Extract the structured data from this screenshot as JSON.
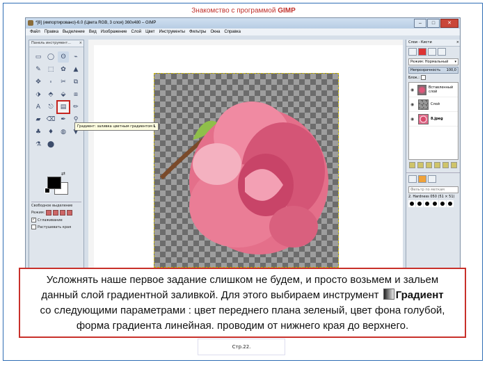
{
  "slide": {
    "title_prefix": "Знакомство с программой",
    "title_bold": "GIMP",
    "page": "Стр.22."
  },
  "window": {
    "title": "*[8] (импортировано)-6.0 (Цвета RGB, 3 слоя) 360x480 – GIMP",
    "buttons": {
      "minimize": "–",
      "maximize": "□",
      "close": "✕"
    }
  },
  "menu": [
    "Файл",
    "Правка",
    "Выделение",
    "Вид",
    "Изображение",
    "Слой",
    "Цвет",
    "Инструменты",
    "Фильтры",
    "Окна",
    "Справка"
  ],
  "toolbox": {
    "title": "Панель инструмент...",
    "close": "×",
    "tools": [
      "▭",
      "◯",
      "ʘ",
      "⌁",
      "✎",
      "⬚",
      "✿",
      "▲",
      "✥",
      "⬞",
      "✂",
      "⧉",
      "⬗",
      "⬘",
      "⬙",
      "⧈",
      "A",
      "⎋",
      "▤",
      "✏",
      "▰",
      "⌫",
      "✒",
      "⚲",
      "♣",
      "♦",
      "◍",
      "▼",
      "⚗",
      "⬤",
      "",
      ""
    ],
    "options_title": "Свободное выделение",
    "mode_label": "Режим:",
    "antialias_label": "Сглаживание",
    "feather_label": "Растушевать края",
    "antialias_checked": "✓"
  },
  "tooltip": "Градиент: заливка цветным градиентом",
  "tooltip_key": "L",
  "dock": {
    "title": "Слои - Кисти",
    "close": "×",
    "mode_label": "Режим: Нормальный",
    "mode_arrow": "▾",
    "opacity_label": "Непрозрачность",
    "opacity_value": "100,0",
    "lock_label": "Блок.:",
    "layers": [
      {
        "name": "Вставленный слой",
        "bold": false
      },
      {
        "name": "Слой",
        "bold": false
      },
      {
        "name": "8.jpeg",
        "bold": true
      }
    ],
    "filter_placeholder": "Фильтр по меткам",
    "brush_name": "2. Hardness 050 (51 × 51)"
  },
  "note": {
    "line1": "Усложнять наше первое задание слишком не будем, и просто возьмем и зальем",
    "line2a": "данный слой градиентной заливкой. Для этого выбираем инструмент",
    "line2b": "Градиент",
    "line3": "со следующими параметрами : цвет переднего плана зеленый, цвет фона голубой,",
    "line4": "форма градиента линейная. проводим от нижнего края до верхнего."
  }
}
